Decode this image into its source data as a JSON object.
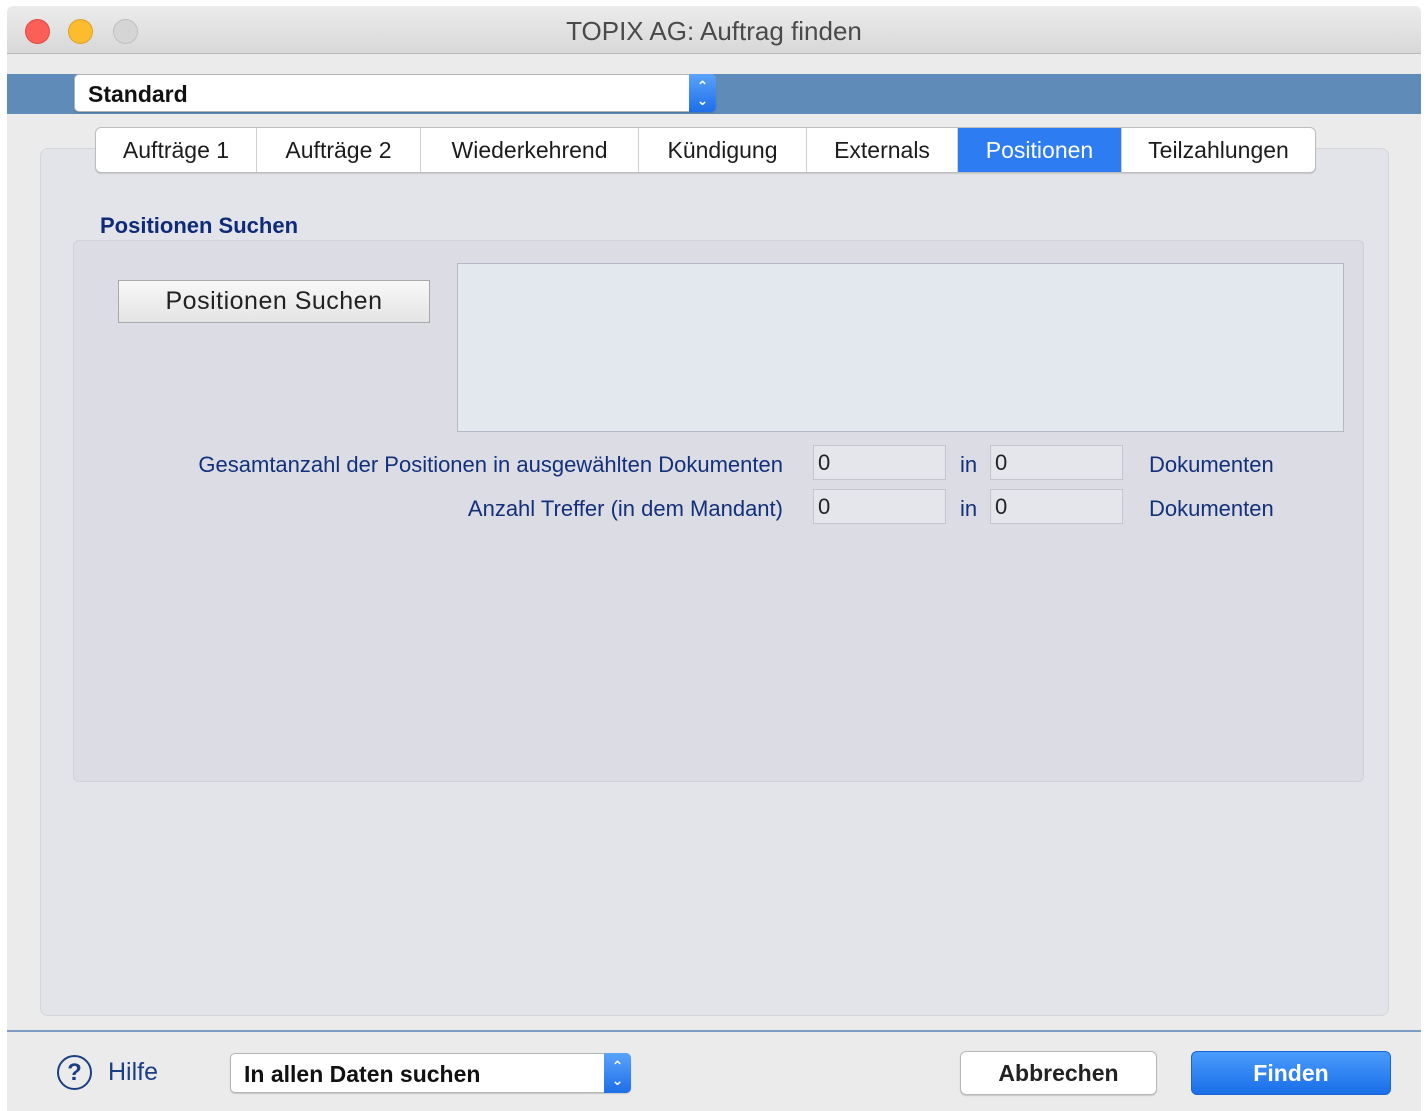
{
  "window": {
    "title": "TOPIX AG: Auftrag finden"
  },
  "toolbar": {
    "view_selector": "Standard"
  },
  "tabs": [
    {
      "label": "Aufträge 1",
      "active": false
    },
    {
      "label": "Aufträge 2",
      "active": false
    },
    {
      "label": "Wiederkehrend",
      "active": false
    },
    {
      "label": "Kündigung",
      "active": false
    },
    {
      "label": "Externals",
      "active": false
    },
    {
      "label": "Positionen",
      "active": true
    },
    {
      "label": "Teilzahlungen",
      "active": false
    }
  ],
  "positionen": {
    "section_title": "Positionen Suchen",
    "search_button": "Positionen Suchen",
    "result_area_text": "",
    "rows": [
      {
        "label": "Gesamtanzahl der Positionen in ausgewählten Dokumenten",
        "count": "0",
        "in_label": "in",
        "documents": "0",
        "unit": "Dokumenten"
      },
      {
        "label": "Anzahl Treffer (in dem Mandant)",
        "count": "0",
        "in_label": "in",
        "documents": "0",
        "unit": "Dokumenten"
      }
    ]
  },
  "footer": {
    "help_label": "Hilfe",
    "scope_selector": "In allen Daten suchen",
    "cancel_label": "Abbrechen",
    "find_label": "Finden"
  },
  "colors": {
    "accent": "#2e7cf2",
    "label_text": "#13307a",
    "blue_strip": "#5f8bb8"
  }
}
